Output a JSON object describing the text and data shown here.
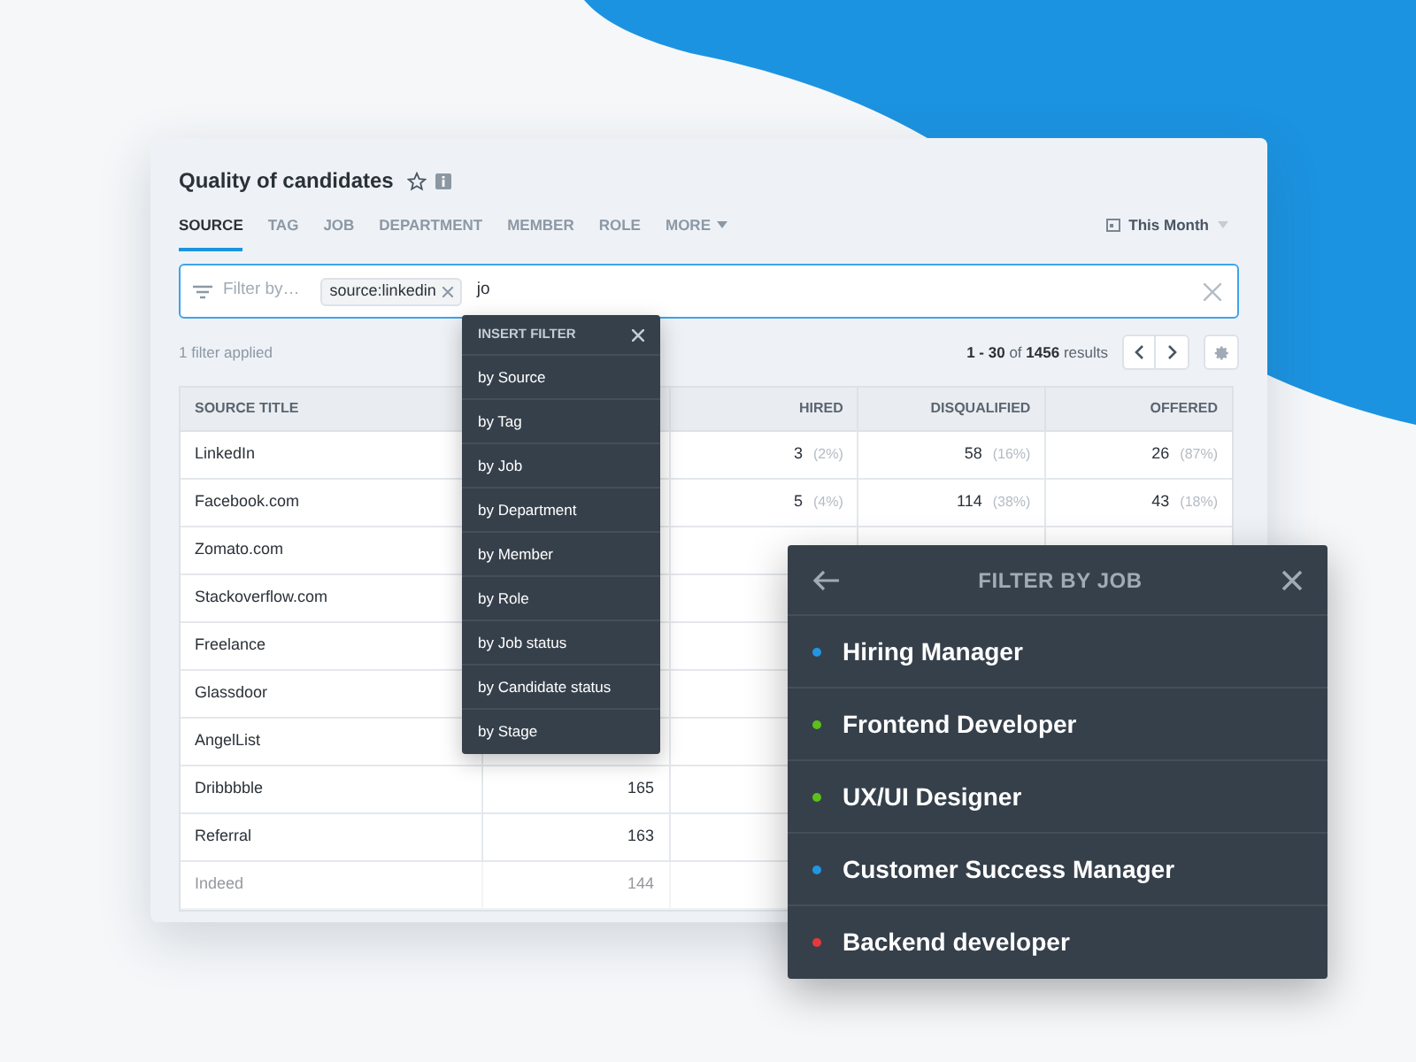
{
  "report": {
    "title": "Quality of candidates"
  },
  "tabs": [
    {
      "label": "SOURCE",
      "selected": true
    },
    {
      "label": "TAG",
      "selected": false
    },
    {
      "label": "JOB",
      "selected": false
    },
    {
      "label": "DEPARTMENT",
      "selected": false
    },
    {
      "label": "MEMBER",
      "selected": false
    },
    {
      "label": "ROLE",
      "selected": false
    },
    {
      "label": "MORE",
      "selected": false
    }
  ],
  "date_range": "This Month",
  "filter_bar": {
    "placeholder": "Filter by…",
    "chip": "source:linkedin",
    "value": "jo"
  },
  "filters_applied": "1 filter applied",
  "pagination": {
    "range": "1 - 30",
    "of": "of",
    "total": "1456",
    "suffix": "results"
  },
  "table": {
    "columns": [
      "SOURCE TITLE",
      null,
      "HIRED",
      "DISQUALIFIED",
      "OFFERED"
    ],
    "rows": [
      {
        "cells": [
          {
            "value": "LinkedIn"
          },
          null,
          {
            "value": "3",
            "pct": "(2%)"
          },
          {
            "value": "58",
            "pct": "(16%)"
          },
          {
            "value": "26",
            "pct": "(87%)"
          }
        ],
        "faded": false
      },
      {
        "cells": [
          {
            "value": "Facebook.com"
          },
          null,
          {
            "value": "5",
            "pct": "(4%)"
          },
          {
            "value": "114",
            "pct": "(38%)"
          },
          {
            "value": "43",
            "pct": "(18%)"
          }
        ],
        "faded": false
      },
      {
        "cells": [
          {
            "value": "Zomato.com"
          },
          null,
          null,
          null,
          null
        ],
        "faded": false
      },
      {
        "cells": [
          {
            "value": "Stackoverflow.com"
          },
          null,
          null,
          null,
          null
        ],
        "faded": false
      },
      {
        "cells": [
          {
            "value": "Freelance"
          },
          null,
          null,
          null,
          null
        ],
        "faded": false
      },
      {
        "cells": [
          {
            "value": "Glassdoor"
          },
          null,
          null,
          null,
          null
        ],
        "faded": false
      },
      {
        "cells": [
          {
            "value": "AngelList"
          },
          null,
          null,
          null,
          null
        ],
        "faded": false
      },
      {
        "cells": [
          {
            "value": "Dribbbble"
          },
          {
            "value": "165"
          },
          null,
          null,
          null
        ],
        "faded": false
      },
      {
        "cells": [
          {
            "value": "Referral"
          },
          {
            "value": "163"
          },
          null,
          null,
          null
        ],
        "faded": false
      },
      {
        "cells": [
          {
            "value": "Indeed"
          },
          {
            "value": "144"
          },
          null,
          null,
          null
        ],
        "faded": true
      }
    ]
  },
  "insert_filter": {
    "title": "INSERT FILTER",
    "items": [
      "by Source",
      "by Tag",
      "by Job",
      "by Department",
      "by Member",
      "by Role",
      "by Job status",
      "by Candidate status",
      "by Stage"
    ]
  },
  "filter_by_job": {
    "title": "FILTER BY JOB",
    "items": [
      {
        "label": "Hiring Manager",
        "color": "#2196e3"
      },
      {
        "label": "Frontend Developer",
        "color": "#5cbf1a"
      },
      {
        "label": "UX/UI Designer",
        "color": "#5cbf1a"
      },
      {
        "label": "Customer Success Manager",
        "color": "#2196e3"
      },
      {
        "label": "Backend developer",
        "color": "#e8383d"
      }
    ]
  }
}
